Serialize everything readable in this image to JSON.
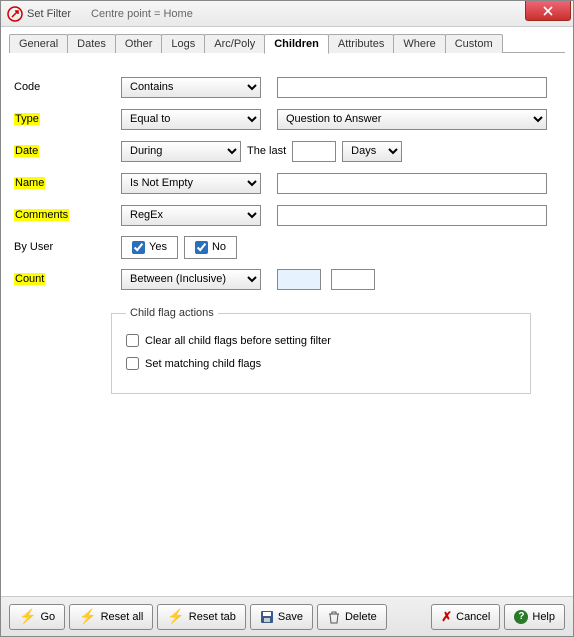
{
  "title": "Set Filter",
  "subtitle": "Centre point = Home",
  "tabs": [
    {
      "label": "General"
    },
    {
      "label": "Dates"
    },
    {
      "label": "Other"
    },
    {
      "label": "Logs"
    },
    {
      "label": "Arc/Poly"
    },
    {
      "label": "Children"
    },
    {
      "label": "Attributes"
    },
    {
      "label": "Where"
    },
    {
      "label": "Custom"
    }
  ],
  "active_tab": "Children",
  "form": {
    "code": {
      "label": "Code",
      "op": "Contains",
      "value": ""
    },
    "type": {
      "label": "Type",
      "op": "Equal to",
      "value": "Question to Answer"
    },
    "date": {
      "label": "Date",
      "op": "During",
      "thelast": "The last",
      "num": "",
      "unit": "Days"
    },
    "name": {
      "label": "Name",
      "op": "Is Not Empty",
      "value": ""
    },
    "comments": {
      "label": "Comments",
      "op": "RegEx",
      "value": ""
    },
    "byuser": {
      "label": "By User",
      "yes": "Yes",
      "no": "No"
    },
    "count": {
      "label": "Count",
      "op": "Between (Inclusive)",
      "v1": "",
      "v2": ""
    }
  },
  "flags": {
    "legend": "Child flag actions",
    "clear": "Clear all child flags before setting filter",
    "set": "Set matching child flags"
  },
  "footer": {
    "go": "Go",
    "resetall": "Reset all",
    "resettab": "Reset tab",
    "save": "Save",
    "delete": "Delete",
    "cancel": "Cancel",
    "help": "Help"
  }
}
